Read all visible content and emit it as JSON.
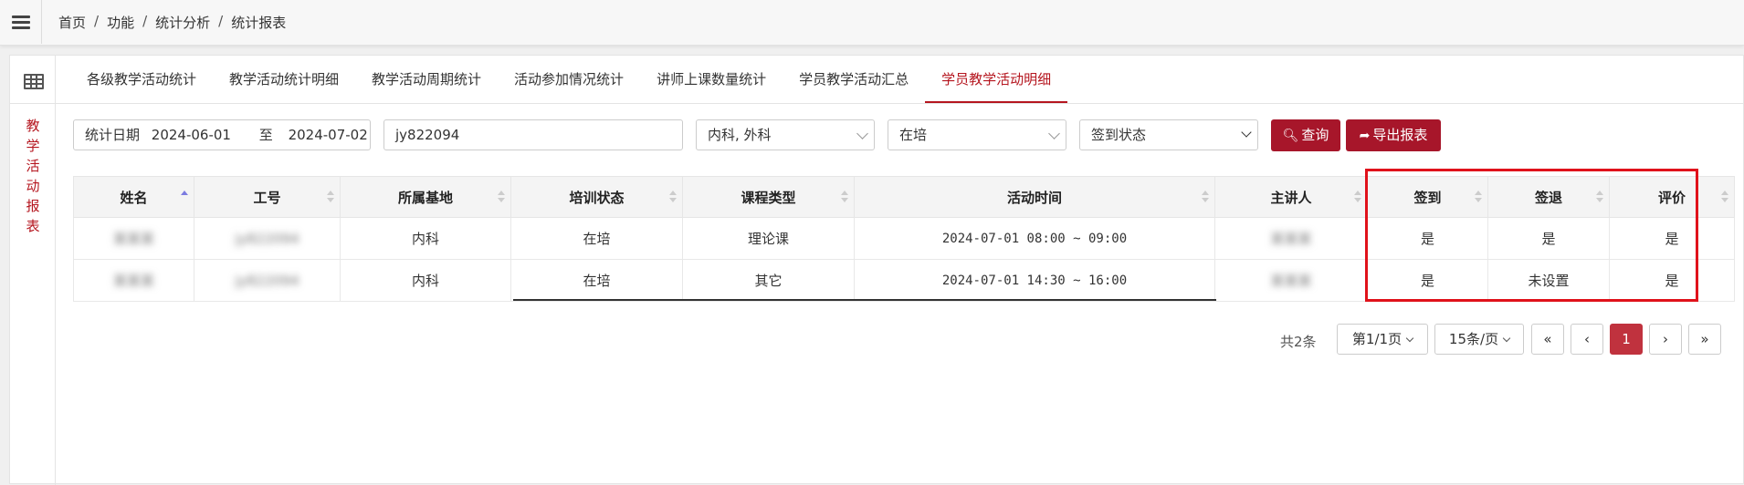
{
  "breadcrumb": [
    "首页",
    "功能",
    "统计分析",
    "统计报表"
  ],
  "rail": {
    "title_chars": [
      "教",
      "学",
      "活",
      "动",
      "报",
      "表"
    ]
  },
  "tabs": [
    "各级教学活动统计",
    "教学活动统计明细",
    "教学活动周期统计",
    "活动参加情况统计",
    "讲师上课数量统计",
    "学员教学活动汇总",
    "学员教学活动明细"
  ],
  "active_tab": 6,
  "filters": {
    "date_label": "统计日期",
    "date_from": "2024-06-01",
    "date_to_label": "至",
    "date_to": "2024-07-02",
    "code": "jy822094",
    "dept": "内科, 外科",
    "train_status": "在培",
    "sign_status_placeholder": "签到状态",
    "query_label": "查询",
    "export_label": "导出报表"
  },
  "table": {
    "headers": [
      "姓名",
      "工号",
      "所属基地",
      "培训状态",
      "课程类型",
      "活动时间",
      "主讲人",
      "签到",
      "签退",
      "评价"
    ],
    "rows": [
      {
        "name": "某某某",
        "id": "jy822094",
        "base": "内科",
        "status": "在培",
        "type": "理论课",
        "time": "2024-07-01 08:00 ~ 09:00",
        "speaker": "某某某",
        "sign_in": "是",
        "sign_out": "是",
        "eval": "是"
      },
      {
        "name": "某某某",
        "id": "jy822094",
        "base": "内科",
        "status": "在培",
        "type": "其它",
        "time": "2024-07-01 14:30 ~ 16:00",
        "speaker": "某某某",
        "sign_in": "是",
        "sign_out": "未设置",
        "eval": "是"
      }
    ]
  },
  "pagination": {
    "total": "共2条",
    "page": "第1/1页",
    "page_size": "15条/页",
    "first": "«",
    "prev": "‹",
    "current": "1",
    "next": "›",
    "last": "»"
  },
  "colors": {
    "accent": "#a7162a",
    "highlight": "#e0121b"
  }
}
